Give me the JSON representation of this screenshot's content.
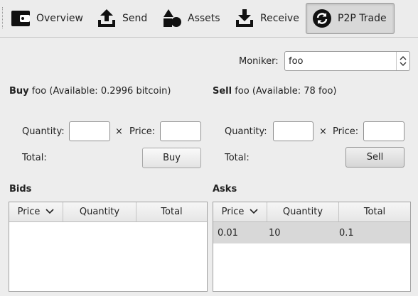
{
  "toolbar": {
    "overview": "Overview",
    "send": "Send",
    "assets": "Assets",
    "receive": "Receive",
    "p2p": "P2P Trade"
  },
  "moniker": {
    "label": "Moniker:",
    "value": "foo"
  },
  "buy": {
    "title": "Buy",
    "subtitle": "foo (Available: 0.2996 bitcoin)",
    "quantity_label": "Quantity:",
    "times": "×",
    "price_label": "Price:",
    "total_label": "Total:",
    "button": "Buy"
  },
  "sell": {
    "title": "Sell",
    "subtitle": "foo (Available: 78 foo)",
    "quantity_label": "Quantity:",
    "times": "×",
    "price_label": "Price:",
    "total_label": "Total:",
    "button": "Sell"
  },
  "bids": {
    "title": "Bids",
    "columns": [
      "Price",
      "Quantity",
      "Total"
    ],
    "rows": []
  },
  "asks": {
    "title": "Asks",
    "columns": [
      "Price",
      "Quantity",
      "Total"
    ],
    "rows": [
      {
        "price": "0.01",
        "quantity": "10",
        "total": "0.1"
      }
    ]
  }
}
